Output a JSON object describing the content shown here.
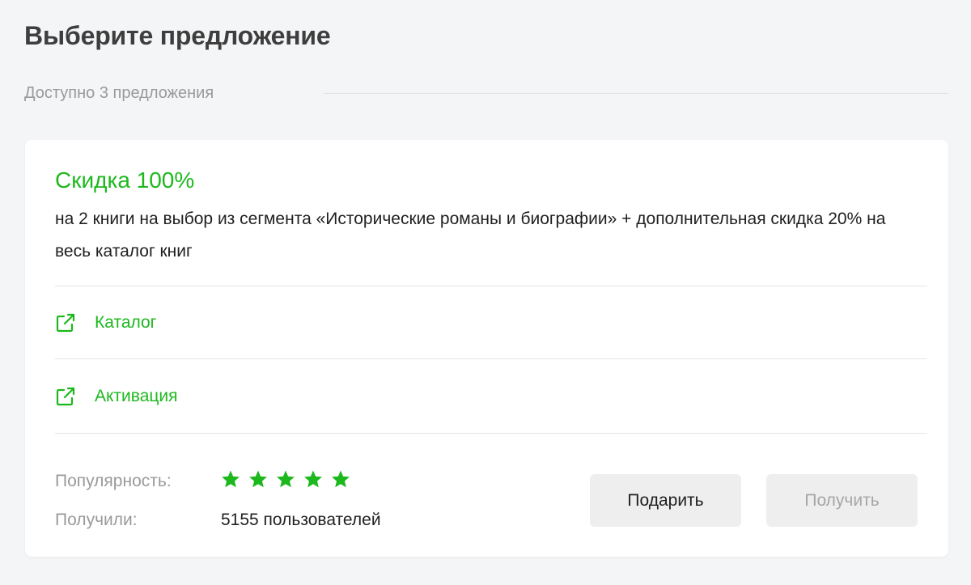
{
  "header": {
    "title": "Выберите предложение",
    "available": "Доступно 3 предложения"
  },
  "offer": {
    "title": "Скидка 100%",
    "description": "на 2 книги на выбор из сегмента «Исторические романы и биографии» + дополнительная скидка 20% на весь каталог книг",
    "links": [
      {
        "label": "Каталог",
        "icon": "external-link-icon"
      },
      {
        "label": "Активация",
        "icon": "external-link-icon"
      }
    ],
    "popularity_label": "Популярность:",
    "popularity_stars": 5,
    "popularity_max": 5,
    "received_label": "Получили:",
    "received_value": "5155 пользователей",
    "buttons": {
      "gift": "Подарить",
      "get": "Получить"
    }
  },
  "colors": {
    "accent": "#1db81d",
    "background": "#f4f5f7",
    "card": "#ffffff",
    "muted_text": "#9a9a9a",
    "button_bg": "#eeeeee"
  }
}
